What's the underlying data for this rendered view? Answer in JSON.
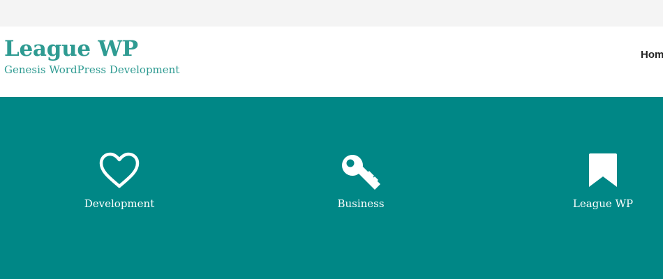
{
  "header": {
    "site_title": "League WP",
    "site_tagline": "Genesis WordPress Development",
    "nav": {
      "items": [
        {
          "label": "Home"
        }
      ]
    }
  },
  "hero": {
    "features": [
      {
        "label": "Development",
        "icon": "heart-icon"
      },
      {
        "label": "Business",
        "icon": "key-icon"
      },
      {
        "label": "League WP",
        "icon": "bookmark-icon"
      }
    ]
  },
  "colors": {
    "brand": "#2f9b92",
    "hero_background": "#008786",
    "header_background": "#ffffff",
    "page_background": "#f4f4f4",
    "nav_text": "#222222",
    "hero_text": "#ffffff"
  }
}
